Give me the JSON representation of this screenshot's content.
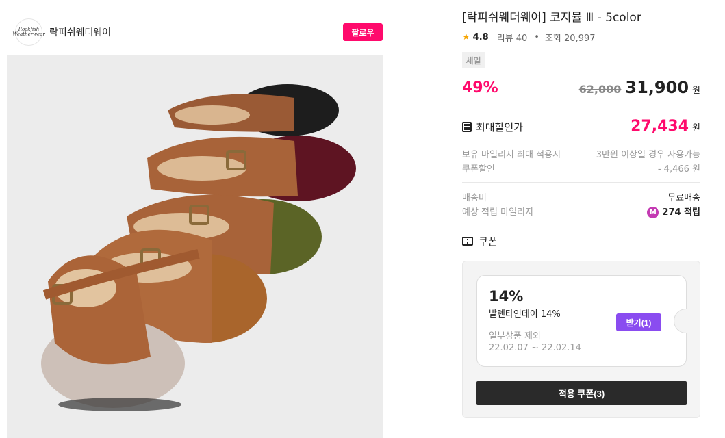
{
  "brand": {
    "logo_text": "Rockfish Weatherwear",
    "name": "락피쉬웨더웨어",
    "follow_label": "팔로우"
  },
  "product": {
    "image_alt": "락피쉬웨더웨어 코지뮬 III 5color shoes",
    "title": "[락피쉬웨더웨어] 코지뮬 Ⅲ - 5color",
    "rating": "4.8",
    "review_label": "리뷰 40",
    "dot": "•",
    "views_label": "조회 20,997",
    "sale_badge": "세일",
    "discount_percent": "49%",
    "original_price": "62,000",
    "current_price": "31,900",
    "currency": "원"
  },
  "max_discount": {
    "label": "최대할인가",
    "price": "27,434",
    "currency": "원"
  },
  "details": {
    "mileage_label": "보유 마일리지 최대 적용시",
    "mileage_value": "3만원 이상일 경우 사용가능",
    "coupon_discount_label": "쿠폰할인",
    "coupon_discount_value": "- 4,466 원",
    "shipping_label": "배송비",
    "shipping_value": "무료배송",
    "expected_mileage_label": "예상 적립 마일리지",
    "mileage_badge": "M",
    "expected_mileage_value": "274 적립"
  },
  "coupon": {
    "section_label": "쿠폰",
    "percent": "14%",
    "name": "발렌타인데이 14%",
    "exclude": "일부상품 제외",
    "period": "22.02.07 ~ 22.02.14",
    "get_label": "받기(1)",
    "apply_label": "적용 쿠폰(3)"
  },
  "colors": {
    "accent": "#ff0a6c",
    "coupon_button": "#8a4cf0",
    "dark_button": "#2a2a2a",
    "star": "#f6a500"
  },
  "icons": [
    "star-icon",
    "calculator-icon",
    "ticket-icon",
    "mileage-m-icon"
  ]
}
